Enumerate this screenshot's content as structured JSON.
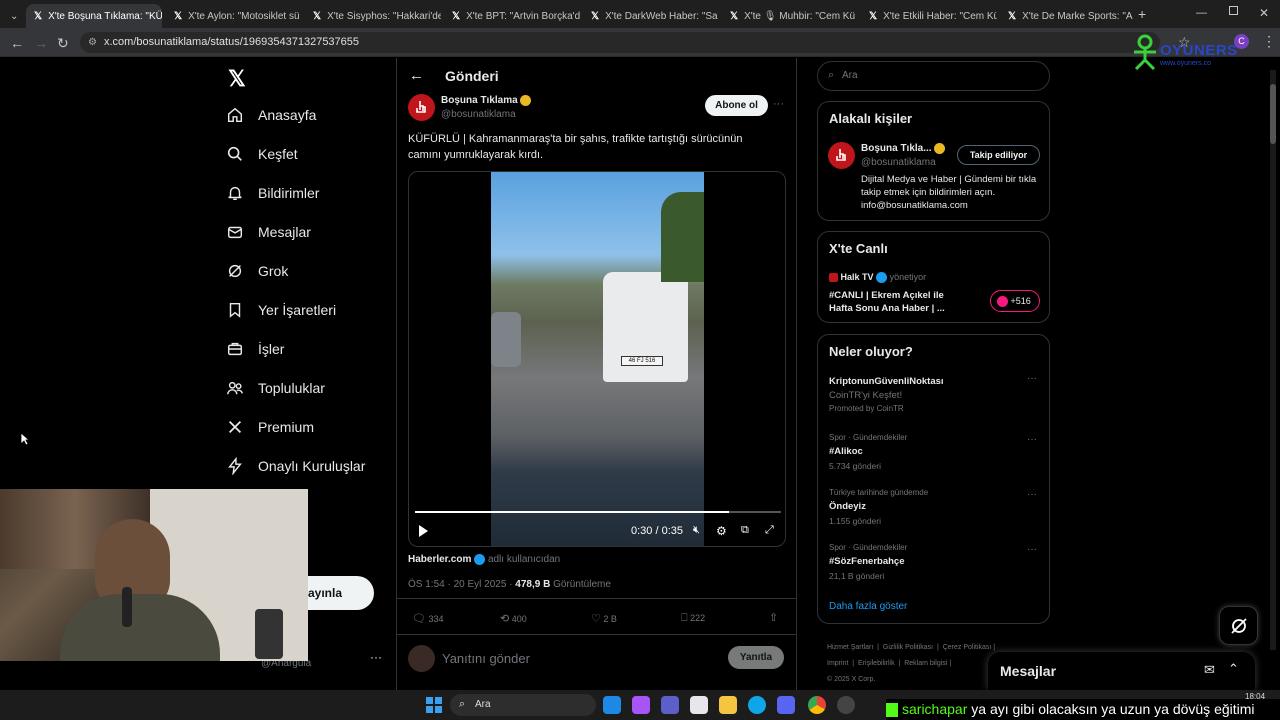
{
  "browser": {
    "tabs": [
      {
        "title": "X'te Boşuna Tıklama: \"KÜ",
        "active": true
      },
      {
        "title": "X'te Aylon: \"Motosiklet sü"
      },
      {
        "title": "X'te Sisyphos: \"Hakkari'de"
      },
      {
        "title": "X'te BPT: \"Artvin Borçka'd"
      },
      {
        "title": "X'te DarkWeb Haber: \"Sa"
      },
      {
        "title": "X'te 🎙 Muhbir: \"Cem Kü"
      },
      {
        "title": "X'te Etkili Haber: \"Cem Kü"
      },
      {
        "title": "X'te De Marke Sports: \"A"
      }
    ],
    "url": "x.com/bosunatiklama/status/1969354371327537655"
  },
  "nav": {
    "items": [
      {
        "label": "Anasayfa",
        "icon": "home-icon"
      },
      {
        "label": "Keşfet",
        "icon": "search-icon"
      },
      {
        "label": "Bildirimler",
        "icon": "bell-icon"
      },
      {
        "label": "Mesajlar",
        "icon": "mail-icon"
      },
      {
        "label": "Grok",
        "icon": "grok-icon"
      },
      {
        "label": "Yer İşaretleri",
        "icon": "bookmark-icon"
      },
      {
        "label": "İşler",
        "icon": "briefcase-icon"
      },
      {
        "label": "Topluluklar",
        "icon": "people-icon"
      },
      {
        "label": "Premium",
        "icon": "x-icon"
      },
      {
        "label": "Onaylı Kuruluşlar",
        "icon": "lightning-icon"
      }
    ],
    "more_partial": "zla",
    "post_partial": "ayınla",
    "handle_partial": "@Anargula",
    "more_dots": "···"
  },
  "post": {
    "header_title": "Gönderi",
    "author_name": "Boşuna Tıklama",
    "author_handle": "@bosunatiklama",
    "subscribe_label": "Abone ol",
    "text": "KÜFÜRLÜ | Kahramanmaraş'ta bir şahıs, trafikte tartıştığı sürücünün camını yumruklayarak kırdı.",
    "video_time": "0:30 / 0:35",
    "video_progress": 0.857,
    "source_name": "Haberler.com",
    "source_suffix": "adlı kullanıcıdan",
    "timestamp": "ÖS 1:54 · 20 Eyl 2025 ·",
    "views_count": "478,9 B",
    "views_label": "Görüntüleme",
    "replies": "334",
    "reposts": "400",
    "likes": "2 B",
    "bookmarks": "222",
    "reply_placeholder": "Yanıtını gönder",
    "reply_button": "Yanıtla",
    "more": "···",
    "plate": "46 FJ 516"
  },
  "right": {
    "search_placeholder": "Ara",
    "related_title": "Alakalı kişiler",
    "related_name": "Boşuna Tıkla...",
    "related_handle": "@bosunatiklama",
    "following_label": "Takip ediliyor",
    "related_bio": "Dijital Medya ve Haber | Gündemi bir tıkla takip etmek için bildirimleri açın. info@bosunatiklama.com",
    "live_title": "X'te Canlı",
    "live_host": "Halk TV",
    "live_host_suffix": "yönetiyor",
    "live_text": "#CANLI | Ekrem Açıkel ile Hafta Sonu Ana Haber | ...",
    "live_count": "+516",
    "trends_title": "Neler oluyor?",
    "trends": [
      {
        "context": "",
        "name": "KriptonunGüvenliNoktası",
        "detail": "CoinTR'yi Keşfet!",
        "extra": "Promoted by CoinTR"
      },
      {
        "context": "Spor · Gündemdekiler",
        "name": "#Alikoc",
        "detail": "5.734 gönderi"
      },
      {
        "context": "Türkiye tarihinde gündemde",
        "name": "Öndeyiz",
        "detail": "1.155 gönderi"
      },
      {
        "context": "Spor · Gündemdekiler",
        "name": "#SözFenerbahçe",
        "detail": "21,1 B gönderi"
      }
    ],
    "show_more": "Daha fazla göster",
    "footer1": [
      "Hizmet Şartları",
      "Gizlilik Politikası",
      "Çerez Politikası"
    ],
    "footer2": [
      "Imprint",
      "Erişilebilirlik",
      "Reklam bilgisi"
    ],
    "copyright": "© 2025 X Corp."
  },
  "messages_drawer": {
    "title": "Mesajlar"
  },
  "watermark": {
    "brand": "OYUNERS",
    "site": "www.oyuners.co"
  },
  "taskbar": {
    "search": "Ara",
    "clock": "18:04"
  },
  "chat": {
    "user": "sarichapar",
    "text": "ya ayı gibi olacaksın ya uzun ya dövüş eğitimi"
  },
  "colors": {
    "accent": "#1d9bf0",
    "brand_red": "#c0151b",
    "bg": "#000000"
  }
}
